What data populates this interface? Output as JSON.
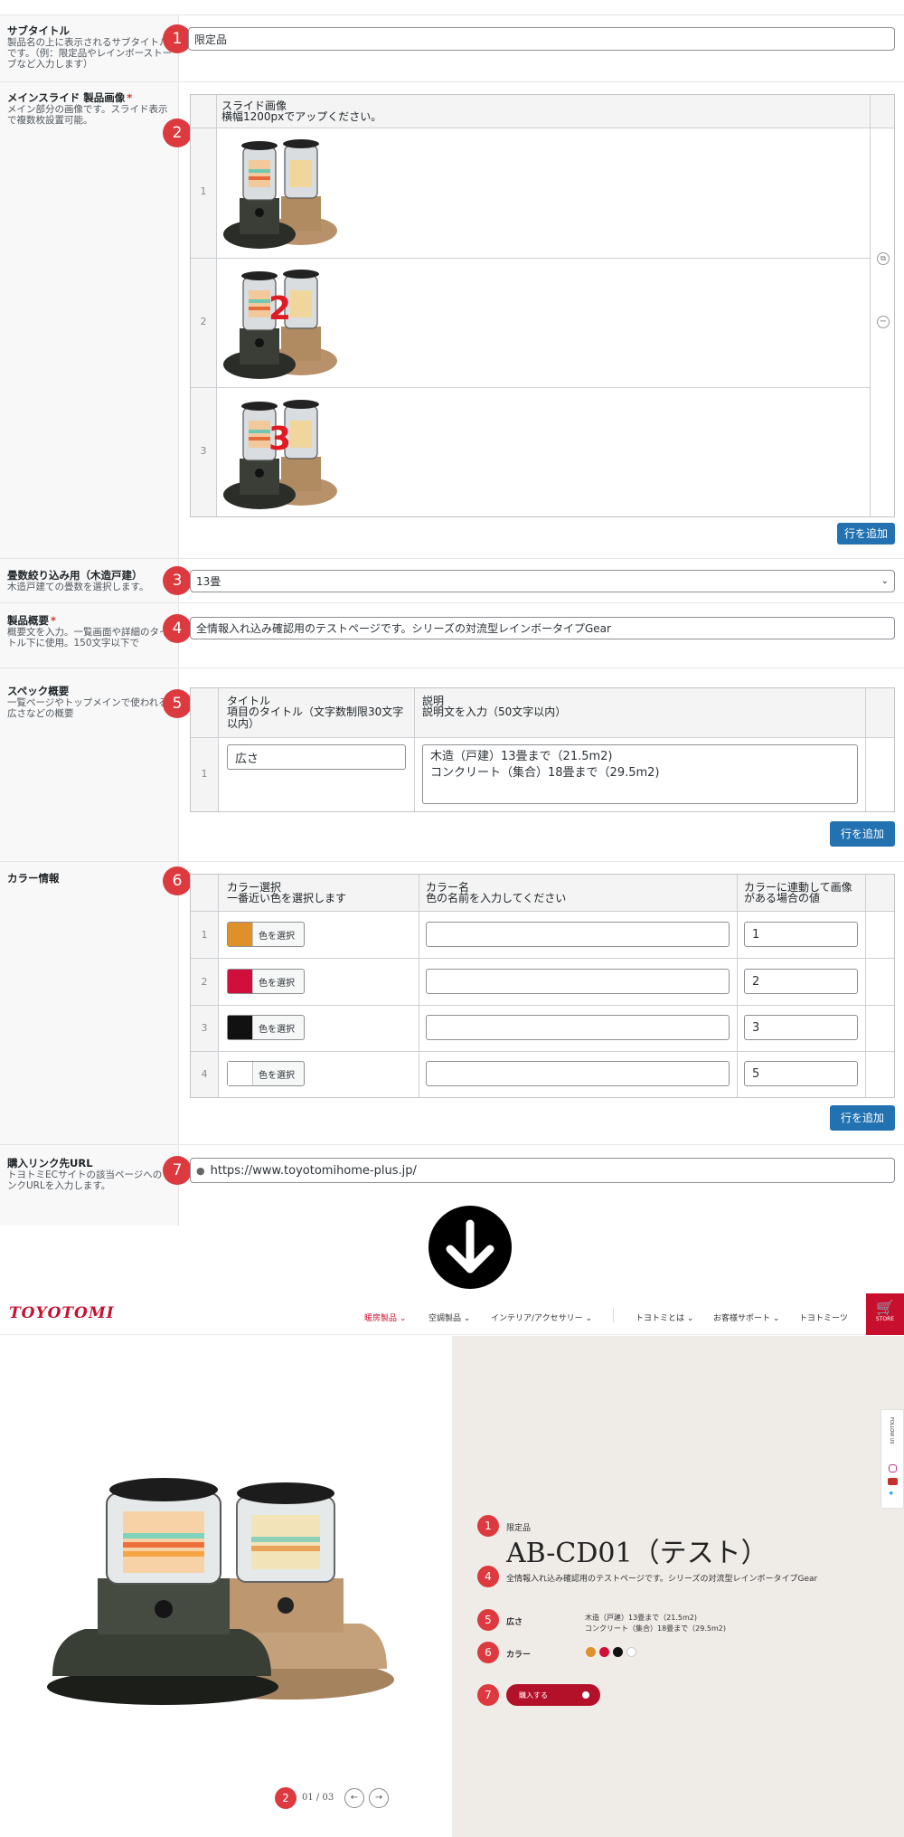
{
  "admin": {
    "fields": {
      "subtitle": {
        "label": "サブタイトル",
        "desc": "製品名の上に表示されるサブタイトルです。（例：限定品やレインボーストーブなど入力します）",
        "value": "限定品",
        "badge": "1"
      },
      "main_slide": {
        "label": "メインスライド 製品画像",
        "required": "*",
        "desc": "メイン部分の画像です。スライド表示で複数枚設置可能。",
        "badge": "2",
        "col_title": "スライド画像",
        "col_desc": "横幅1200pxでアップください。",
        "rows": [
          "1",
          "2",
          "3"
        ],
        "overlay_numbers": [
          "2",
          "3"
        ],
        "add_row": "行を追加"
      },
      "tatami": {
        "label": "畳数絞り込み用（木造戸建）",
        "desc": "木造戸建ての畳数を選択します。",
        "value": "13畳",
        "badge": "3"
      },
      "overview": {
        "label": "製品概要",
        "required": "*",
        "desc": "概要文を入力。一覧画面や詳細のタイトル下に使用。150文字以下で",
        "value": "全情報入れ込み確認用のテストページです。シリーズの対流型レインボータイプGear",
        "badge": "4"
      },
      "spec": {
        "label": "スペック概要",
        "desc": "一覧ページやトップメインで使われる広さなどの概要",
        "badge": "5",
        "col1_title": "タイトル",
        "col1_desc": "項目のタイトル（文字数制限30文字以内）",
        "col2_title": "説明",
        "col2_desc": "説明文を入力（50文字以内）",
        "row_num": "1",
        "title_value": "広さ",
        "desc_line1": "木造（戸建）13畳まで（21.5m2)",
        "desc_line2": "コンクリート（集合）18畳まで（29.5m2)",
        "add_row": "行を追加"
      },
      "color": {
        "label": "カラー情報",
        "badge": "6",
        "col1_title": "カラー選択",
        "col1_desc": "一番近い色を選択します",
        "col2_title": "カラー名",
        "col2_desc": "色の名前を入力してください",
        "col3_title": "カラーに連動して画像",
        "col3_desc": "がある場合の値",
        "button_label": "色を選択",
        "rows": [
          {
            "num": "1",
            "color": "#e0902a",
            "value": "1"
          },
          {
            "num": "2",
            "color": "#d0103a",
            "value": "2"
          },
          {
            "num": "3",
            "color": "#111111",
            "value": "3"
          },
          {
            "num": "4",
            "color": "#ffffff",
            "value": "5"
          }
        ],
        "add_row": "行を追加"
      },
      "purchase": {
        "label": "購入リンク先URL",
        "desc": "トヨトミECサイトの該当ページへのリンクURLを入力します。",
        "value": "https://www.toyotomihome-plus.jp/",
        "badge": "7"
      }
    }
  },
  "site": {
    "logo": "TOYOTOMI",
    "nav": [
      "暖房製品",
      "空調製品",
      "インテリア/アクセサリー",
      "トヨトミとは",
      "お客様サポート",
      "トヨトミーツ"
    ],
    "store_label": "STORE",
    "follow": "FOLLOW US",
    "subtitle": "限定品",
    "product_name": "AB-CD01（テスト）",
    "overview": "全情報入れ込み確認用のテストページです。シリーズの対流型レインボータイプGear",
    "spec_label": "広さ",
    "spec_line1": "木造（戸建）13畳まで（21.5m2)",
    "spec_line2": "コンクリート（集合）18畳まで（29.5m2)",
    "color_label": "カラー",
    "colors": [
      "#e0902a",
      "#d0103a",
      "#111111",
      "#ffffff"
    ],
    "buy_label": "購入する",
    "pager": "01 / 03",
    "badges": [
      "1",
      "4",
      "5",
      "6",
      "7",
      "2"
    ]
  }
}
